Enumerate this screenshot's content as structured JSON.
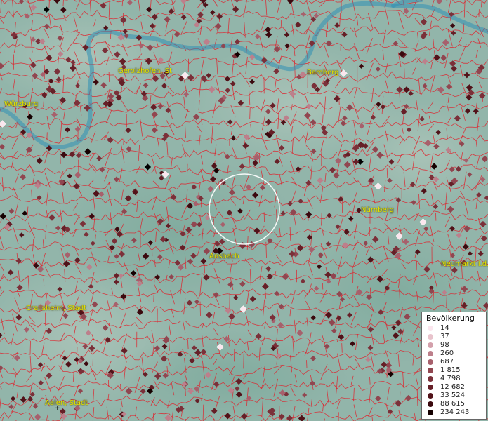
{
  "map": {
    "cities": [
      {
        "name": "Gerolzhofen, St",
        "id": "gerolzhofen"
      },
      {
        "name": "Bamberg",
        "id": "bamberg"
      },
      {
        "name": "Würzburg",
        "id": "wuerzburg"
      },
      {
        "name": "Nürnberg",
        "id": "nuernberg"
      },
      {
        "name": "Ansbach",
        "id": "ansbach"
      },
      {
        "name": "Neumarkt i.d.",
        "id": "neumarkt"
      },
      {
        "name": "Crailsheim, Stadt",
        "id": "crailsheim"
      },
      {
        "name": "Aalen, Stadt",
        "id": "aalen"
      }
    ],
    "colors": {
      "terrain": "#8fb3a8",
      "rivers": "#2f8fb5",
      "boundaries": "#e0202a",
      "label": "#e8e800",
      "selection_circle": "#ffffff"
    }
  },
  "legend": {
    "title": "Bevölkerung",
    "items": [
      {
        "label": "14",
        "color": "#fbe6ee"
      },
      {
        "label": "37",
        "color": "#e8c3cc"
      },
      {
        "label": "98",
        "color": "#d3a0ab"
      },
      {
        "label": "260",
        "color": "#bd7f8b"
      },
      {
        "label": "687",
        "color": "#a7606c"
      },
      {
        "label": "1 815",
        "color": "#914650"
      },
      {
        "label": "4 798",
        "color": "#7b3039"
      },
      {
        "label": "12 682",
        "color": "#661f27"
      },
      {
        "label": "33 524",
        "color": "#511219"
      },
      {
        "label": "88 615",
        "color": "#3b090e"
      },
      {
        "label": "234 243",
        "color": "#150000"
      }
    ],
    "plus": "+"
  }
}
